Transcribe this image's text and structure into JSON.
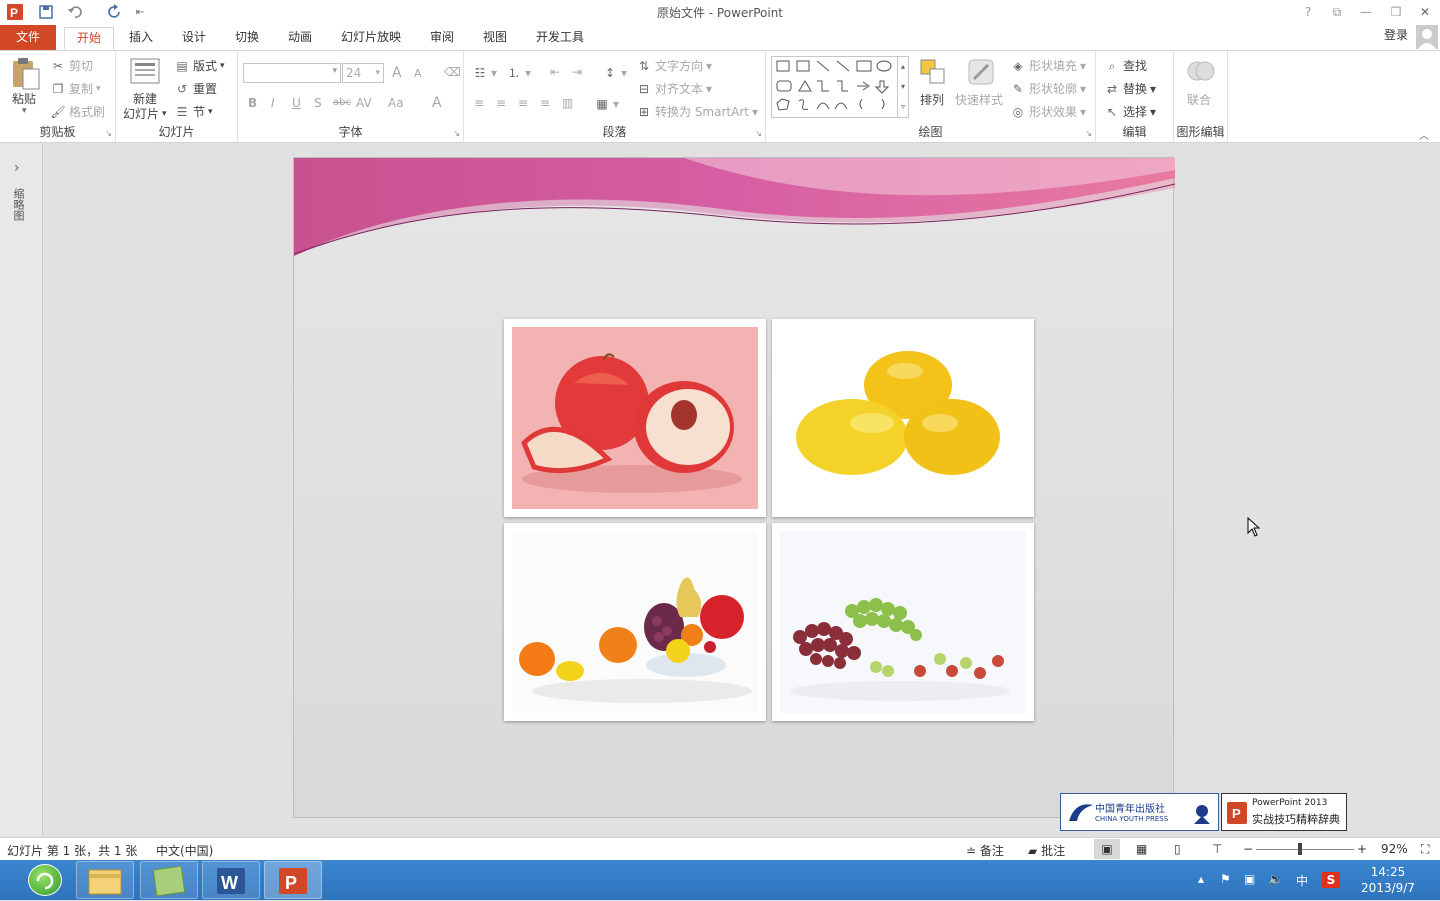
{
  "titlebar": {
    "title": "原始文件 - PowerPoint",
    "help": "?",
    "restore_ribbon": "⧉",
    "minimize": "—",
    "maximize": "❐",
    "close": "✕",
    "qa_more": "⇤"
  },
  "tabs": [
    "文件",
    "开始",
    "插入",
    "设计",
    "切换",
    "动画",
    "幻灯片放映",
    "审阅",
    "视图",
    "开发工具"
  ],
  "account": {
    "login": "登录"
  },
  "ribbon": {
    "clipboard": {
      "label": "剪贴板",
      "paste": "粘贴",
      "cut": "剪切",
      "copy": "复制",
      "painter": "格式刷"
    },
    "slides": {
      "label": "幻灯片",
      "new_slide_1": "新建",
      "new_slide_2": "幻灯片",
      "layout": "版式",
      "reset": "重置",
      "section": "节"
    },
    "font": {
      "label": "字体",
      "font_name": "",
      "font_size": "24",
      "bold": "B",
      "italic": "I",
      "underline": "U",
      "shadow": "S",
      "strike": "abc",
      "spacing": "AV",
      "case": "Aa",
      "grow": "A",
      "shrink": "A",
      "clear": "A",
      "color": "A"
    },
    "paragraph": {
      "label": "段落",
      "text_direction": "文字方向",
      "align_text": "对齐文本",
      "smartart": "转换为 SmartArt"
    },
    "drawing": {
      "label": "绘图",
      "arrange": "排列",
      "quick_styles": "快速样式",
      "shape_fill": "形状填充",
      "shape_outline": "形状轮廓",
      "shape_effects": "形状效果"
    },
    "editing": {
      "label": "编辑",
      "find": "查找",
      "replace": "替换",
      "select": "选择"
    },
    "shape_edit": {
      "label": "图形编辑",
      "combine": "联合"
    }
  },
  "leftpane": {
    "thumbnails": "缩略图",
    "expand": "›"
  },
  "slide": {
    "photos": [
      {
        "name": "peach"
      },
      {
        "name": "lemons"
      },
      {
        "name": "fruit-bowl"
      },
      {
        "name": "grapes"
      }
    ]
  },
  "logos": {
    "press_cn": "中国青年出版社",
    "press_en": "CHINA YOUTH PRESS",
    "book_line1": "PowerPoint 2013",
    "book_line2": "实战技巧精粹辞典"
  },
  "status": {
    "slide_info": "幻灯片 第 1 张，共 1 张",
    "language": "中文(中国)",
    "notes": "备注",
    "comments": "批注",
    "zoom": "92%",
    "zoom_minus": "−",
    "zoom_plus": "+"
  },
  "taskbar": {
    "time": "14:25",
    "date": "2013/9/7",
    "ime": "中",
    "tray_app": "S"
  },
  "colors": {
    "accent": "#d24726",
    "taskbar": "#3079c4",
    "slide_wave": "#c83c8c"
  }
}
